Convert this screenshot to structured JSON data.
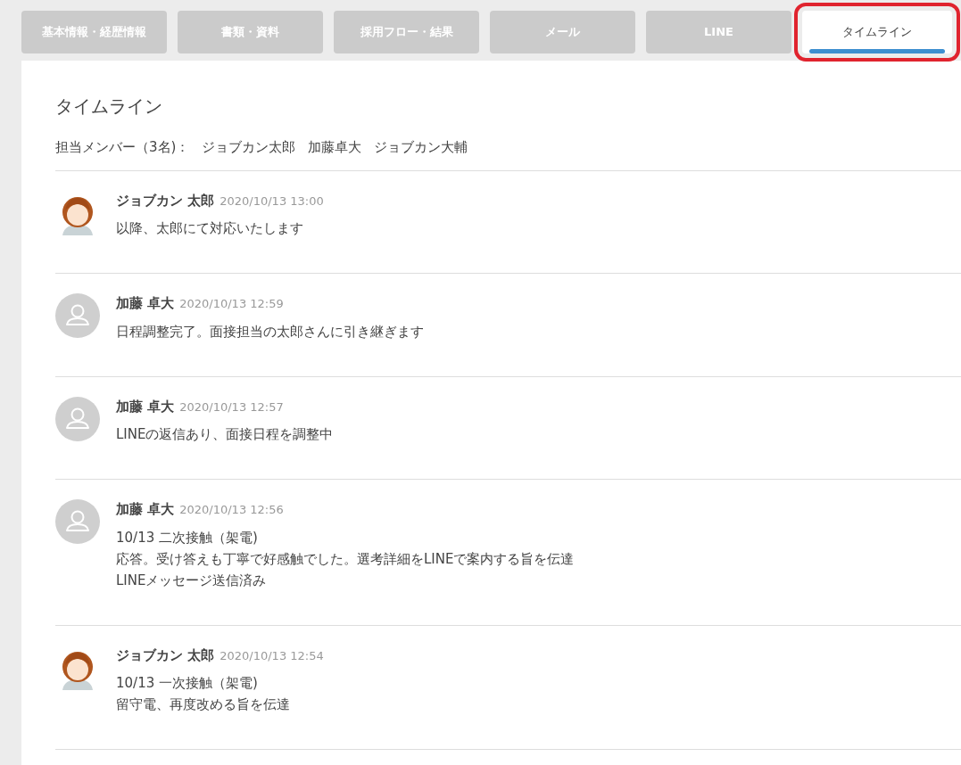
{
  "tabs": [
    {
      "label": "基本情報・経歴情報",
      "selected": false,
      "highlighted": false
    },
    {
      "label": "書類・資料",
      "selected": false,
      "highlighted": false
    },
    {
      "label": "採用フロー・結果",
      "selected": false,
      "highlighted": false
    },
    {
      "label": "メール",
      "selected": false,
      "highlighted": false
    },
    {
      "label": "LINE",
      "selected": false,
      "highlighted": false
    },
    {
      "label": "タイムライン",
      "selected": true,
      "highlighted": true
    }
  ],
  "timeline": {
    "title": "タイムライン",
    "members_label": "担当メンバー（3名)：",
    "members": [
      "ジョブカン太郎",
      "加藤卓大",
      "ジョブカン大輔"
    ],
    "entries": [
      {
        "kind": "illustration",
        "author": "ジョブカン 太郎",
        "time": "2020/10/13 13:00",
        "lines": [
          "以降、太郎にて対応いたします"
        ]
      },
      {
        "kind": "default",
        "author": "加藤 卓大",
        "time": "2020/10/13 12:59",
        "lines": [
          "日程調整完了。面接担当の太郎さんに引き継ぎます"
        ]
      },
      {
        "kind": "default",
        "author": "加藤 卓大",
        "time": "2020/10/13 12:57",
        "lines": [
          "LINEの返信あり、面接日程を調整中"
        ]
      },
      {
        "kind": "default",
        "author": "加藤 卓大",
        "time": "2020/10/13 12:56",
        "lines": [
          "10/13 二次接触（架電)",
          "応答。受け答えも丁寧で好感触でした。選考詳細をLINEで案内する旨を伝達",
          "LINEメッセージ送信済み"
        ]
      },
      {
        "kind": "illustration",
        "author": "ジョブカン 太郎",
        "time": "2020/10/13 12:54",
        "lines": [
          "10/13 一次接触（架電)",
          "留守電、再度改める旨を伝達"
        ]
      }
    ]
  }
}
